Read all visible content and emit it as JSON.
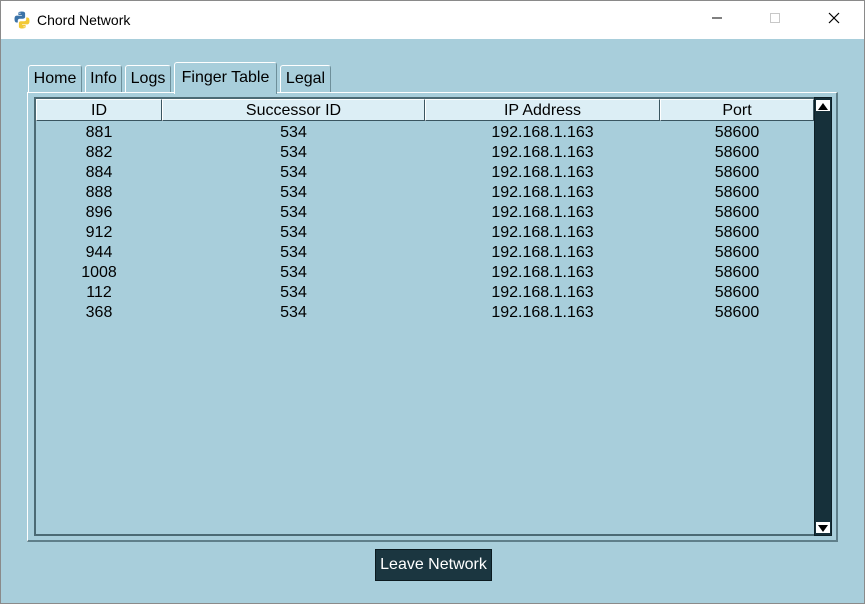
{
  "window": {
    "title": "Chord Network",
    "controls": {
      "minimize": "minimize",
      "maximize": "maximize",
      "close": "close"
    }
  },
  "tabs": [
    {
      "label": "Home"
    },
    {
      "label": "Info"
    },
    {
      "label": "Logs"
    },
    {
      "label": "Finger Table",
      "active": true
    },
    {
      "label": "Legal"
    }
  ],
  "finger_table": {
    "columns": [
      "ID",
      "Successor ID",
      "IP Address",
      "Port"
    ],
    "rows": [
      [
        "881",
        "534",
        "192.168.1.163",
        "58600"
      ],
      [
        "882",
        "534",
        "192.168.1.163",
        "58600"
      ],
      [
        "884",
        "534",
        "192.168.1.163",
        "58600"
      ],
      [
        "888",
        "534",
        "192.168.1.163",
        "58600"
      ],
      [
        "896",
        "534",
        "192.168.1.163",
        "58600"
      ],
      [
        "912",
        "534",
        "192.168.1.163",
        "58600"
      ],
      [
        "944",
        "534",
        "192.168.1.163",
        "58600"
      ],
      [
        "1008",
        "534",
        "192.168.1.163",
        "58600"
      ],
      [
        "112",
        "534",
        "192.168.1.163",
        "58600"
      ],
      [
        "368",
        "534",
        "192.168.1.163",
        "58600"
      ]
    ]
  },
  "actions": {
    "leave_label": "Leave Network"
  },
  "colors": {
    "background": "#a8cedb",
    "button": "#1b3640",
    "scrollbar": "#16303a"
  }
}
